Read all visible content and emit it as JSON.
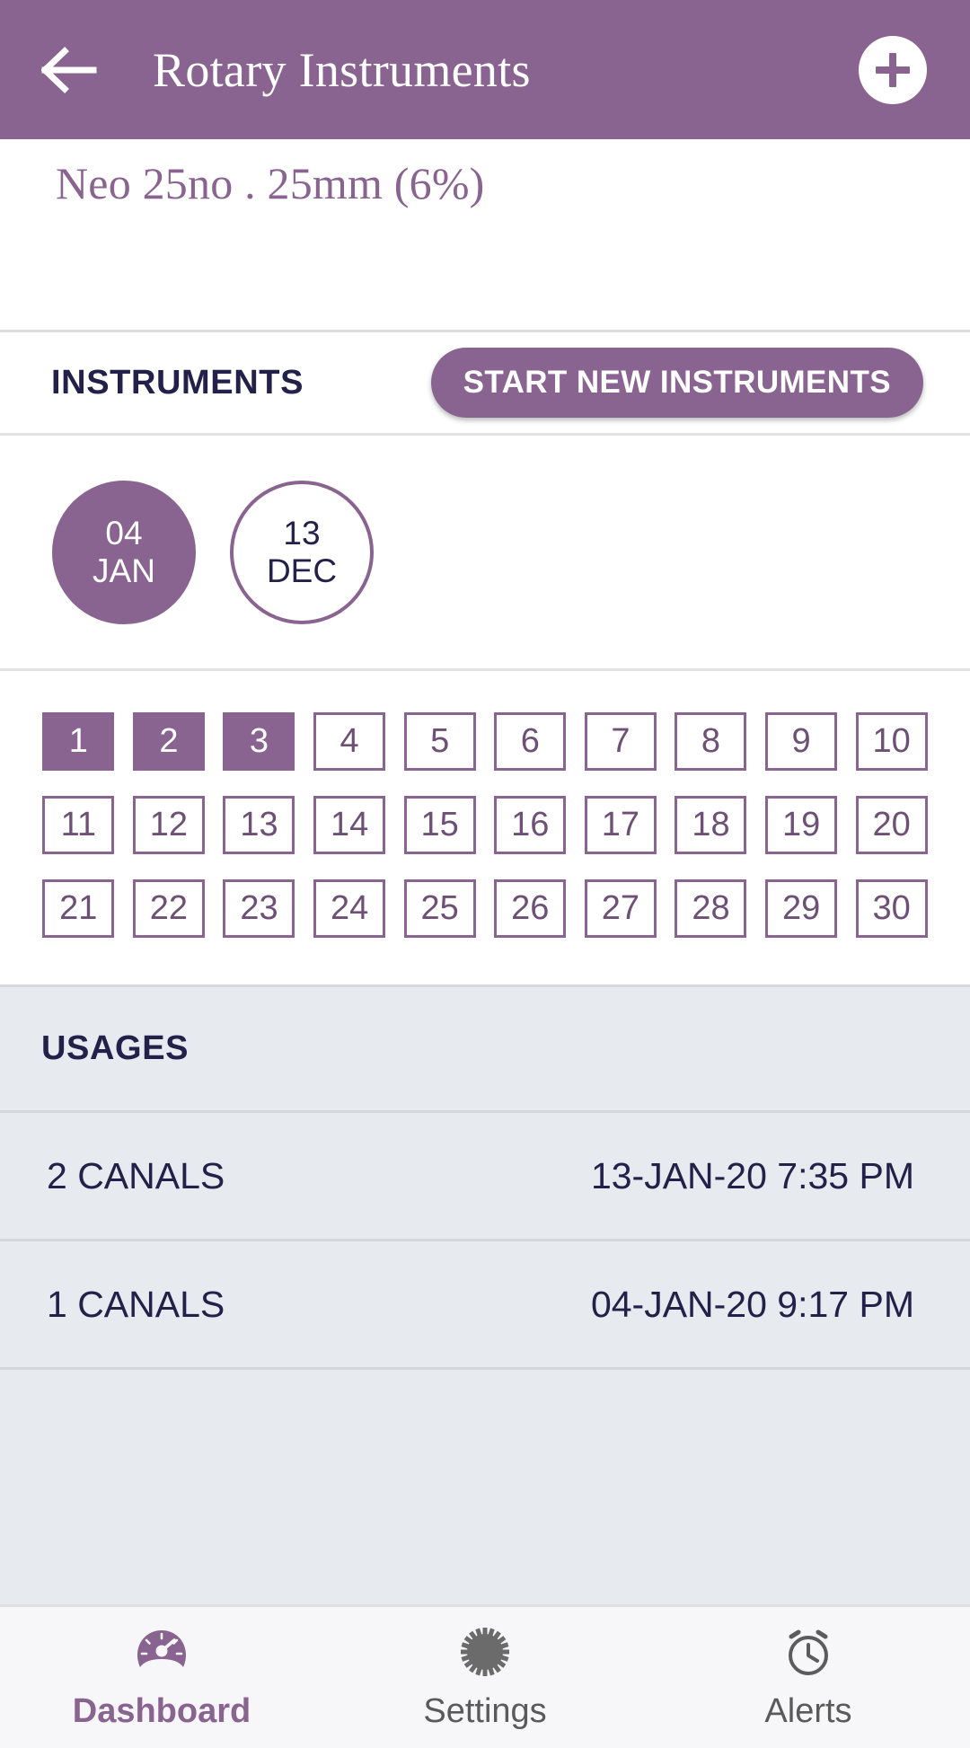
{
  "appbar": {
    "back_icon": "arrow-left-icon",
    "title": "Rotary Instruments",
    "add_icon": "plus-icon",
    "bg_color": "#8a6490"
  },
  "instrument": {
    "name": "Neo 25no . 25mm (6%)",
    "color": "#8a6490"
  },
  "instruments_section": {
    "label": "INSTRUMENTS",
    "start_button": "START NEW INSTRUMENTS"
  },
  "dates": [
    {
      "day": "04",
      "month": "JAN",
      "selected": true
    },
    {
      "day": "13",
      "month": "DEC",
      "selected": false
    }
  ],
  "grid": {
    "cells": [
      {
        "n": "1",
        "used": true
      },
      {
        "n": "2",
        "used": true
      },
      {
        "n": "3",
        "used": true
      },
      {
        "n": "4",
        "used": false
      },
      {
        "n": "5",
        "used": false
      },
      {
        "n": "6",
        "used": false
      },
      {
        "n": "7",
        "used": false
      },
      {
        "n": "8",
        "used": false
      },
      {
        "n": "9",
        "used": false
      },
      {
        "n": "10",
        "used": false
      },
      {
        "n": "11",
        "used": false
      },
      {
        "n": "12",
        "used": false
      },
      {
        "n": "13",
        "used": false
      },
      {
        "n": "14",
        "used": false
      },
      {
        "n": "15",
        "used": false
      },
      {
        "n": "16",
        "used": false
      },
      {
        "n": "17",
        "used": false
      },
      {
        "n": "18",
        "used": false
      },
      {
        "n": "19",
        "used": false
      },
      {
        "n": "20",
        "used": false
      },
      {
        "n": "21",
        "used": false
      },
      {
        "n": "22",
        "used": false
      },
      {
        "n": "23",
        "used": false
      },
      {
        "n": "24",
        "used": false
      },
      {
        "n": "25",
        "used": false
      },
      {
        "n": "26",
        "used": false
      },
      {
        "n": "27",
        "used": false
      },
      {
        "n": "28",
        "used": false
      },
      {
        "n": "29",
        "used": false
      },
      {
        "n": "30",
        "used": false
      }
    ]
  },
  "usages": {
    "label": "USAGES",
    "rows": [
      {
        "canals": "2 CANALS",
        "time": "13-JAN-20 7:35 PM"
      },
      {
        "canals": "1 CANALS",
        "time": "04-JAN-20 9:17 PM"
      }
    ]
  },
  "bottom_nav": {
    "items": [
      {
        "label": "Dashboard",
        "icon": "speedometer-icon",
        "active": true
      },
      {
        "label": "Settings",
        "icon": "gear-icon",
        "active": false
      },
      {
        "label": "Alerts",
        "icon": "alarm-clock-icon",
        "active": false
      }
    ]
  }
}
